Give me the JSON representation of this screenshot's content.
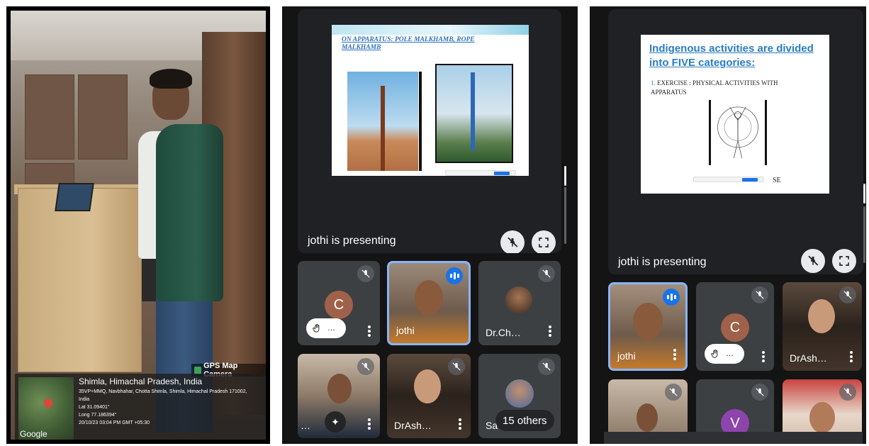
{
  "photo": {
    "gps_badge": "GPS Map Camera",
    "location_title": "Shimla, Himachal Pradesh, India",
    "address": "35VP+MMQ, Navbhahar, Chotta Shimla, Shimla, Himachal Pradesh 171002,",
    "country": "India",
    "lat": "Lat 31.09401°",
    "long": "Long 77.186394°",
    "datetime": "20/10/23 03:04 PM GMT +05:30",
    "map_brand": "Google"
  },
  "meet_left": {
    "slide_title": "ON APPARATUS: POLE MALKHAMB, ROPE MALKHAMB",
    "presenting": "jothi is presenting",
    "tiles": [
      {
        "name": "",
        "avatar_letter": "C",
        "avatar_color": "#a0614a",
        "hand": "…"
      },
      {
        "name": "jothi",
        "speaking": true
      },
      {
        "name": "Dr.Ch…"
      },
      {
        "name": "…"
      },
      {
        "name": "DrAsh…"
      },
      {
        "name": "Sa",
        "others": "15 others"
      }
    ]
  },
  "meet_right": {
    "slide_title": "Indigenous activities are divided into FIVE categories:",
    "slide_num": "1.",
    "slide_sub": "EXERCISE : PHYSICAL ACTIVITIES WITH APPARATUS",
    "slide_tail": "SE",
    "presenting": "jothi is presenting",
    "tiles": [
      {
        "name": "jothi",
        "speaking": true
      },
      {
        "name": "",
        "avatar_letter": "C",
        "avatar_color": "#a0614a",
        "hand": "…"
      },
      {
        "name": "DrAsh…"
      },
      {
        "name": ""
      },
      {
        "name": "",
        "avatar_letter": "V",
        "avatar_color": "#8e44ad"
      },
      {
        "name": ""
      }
    ]
  }
}
